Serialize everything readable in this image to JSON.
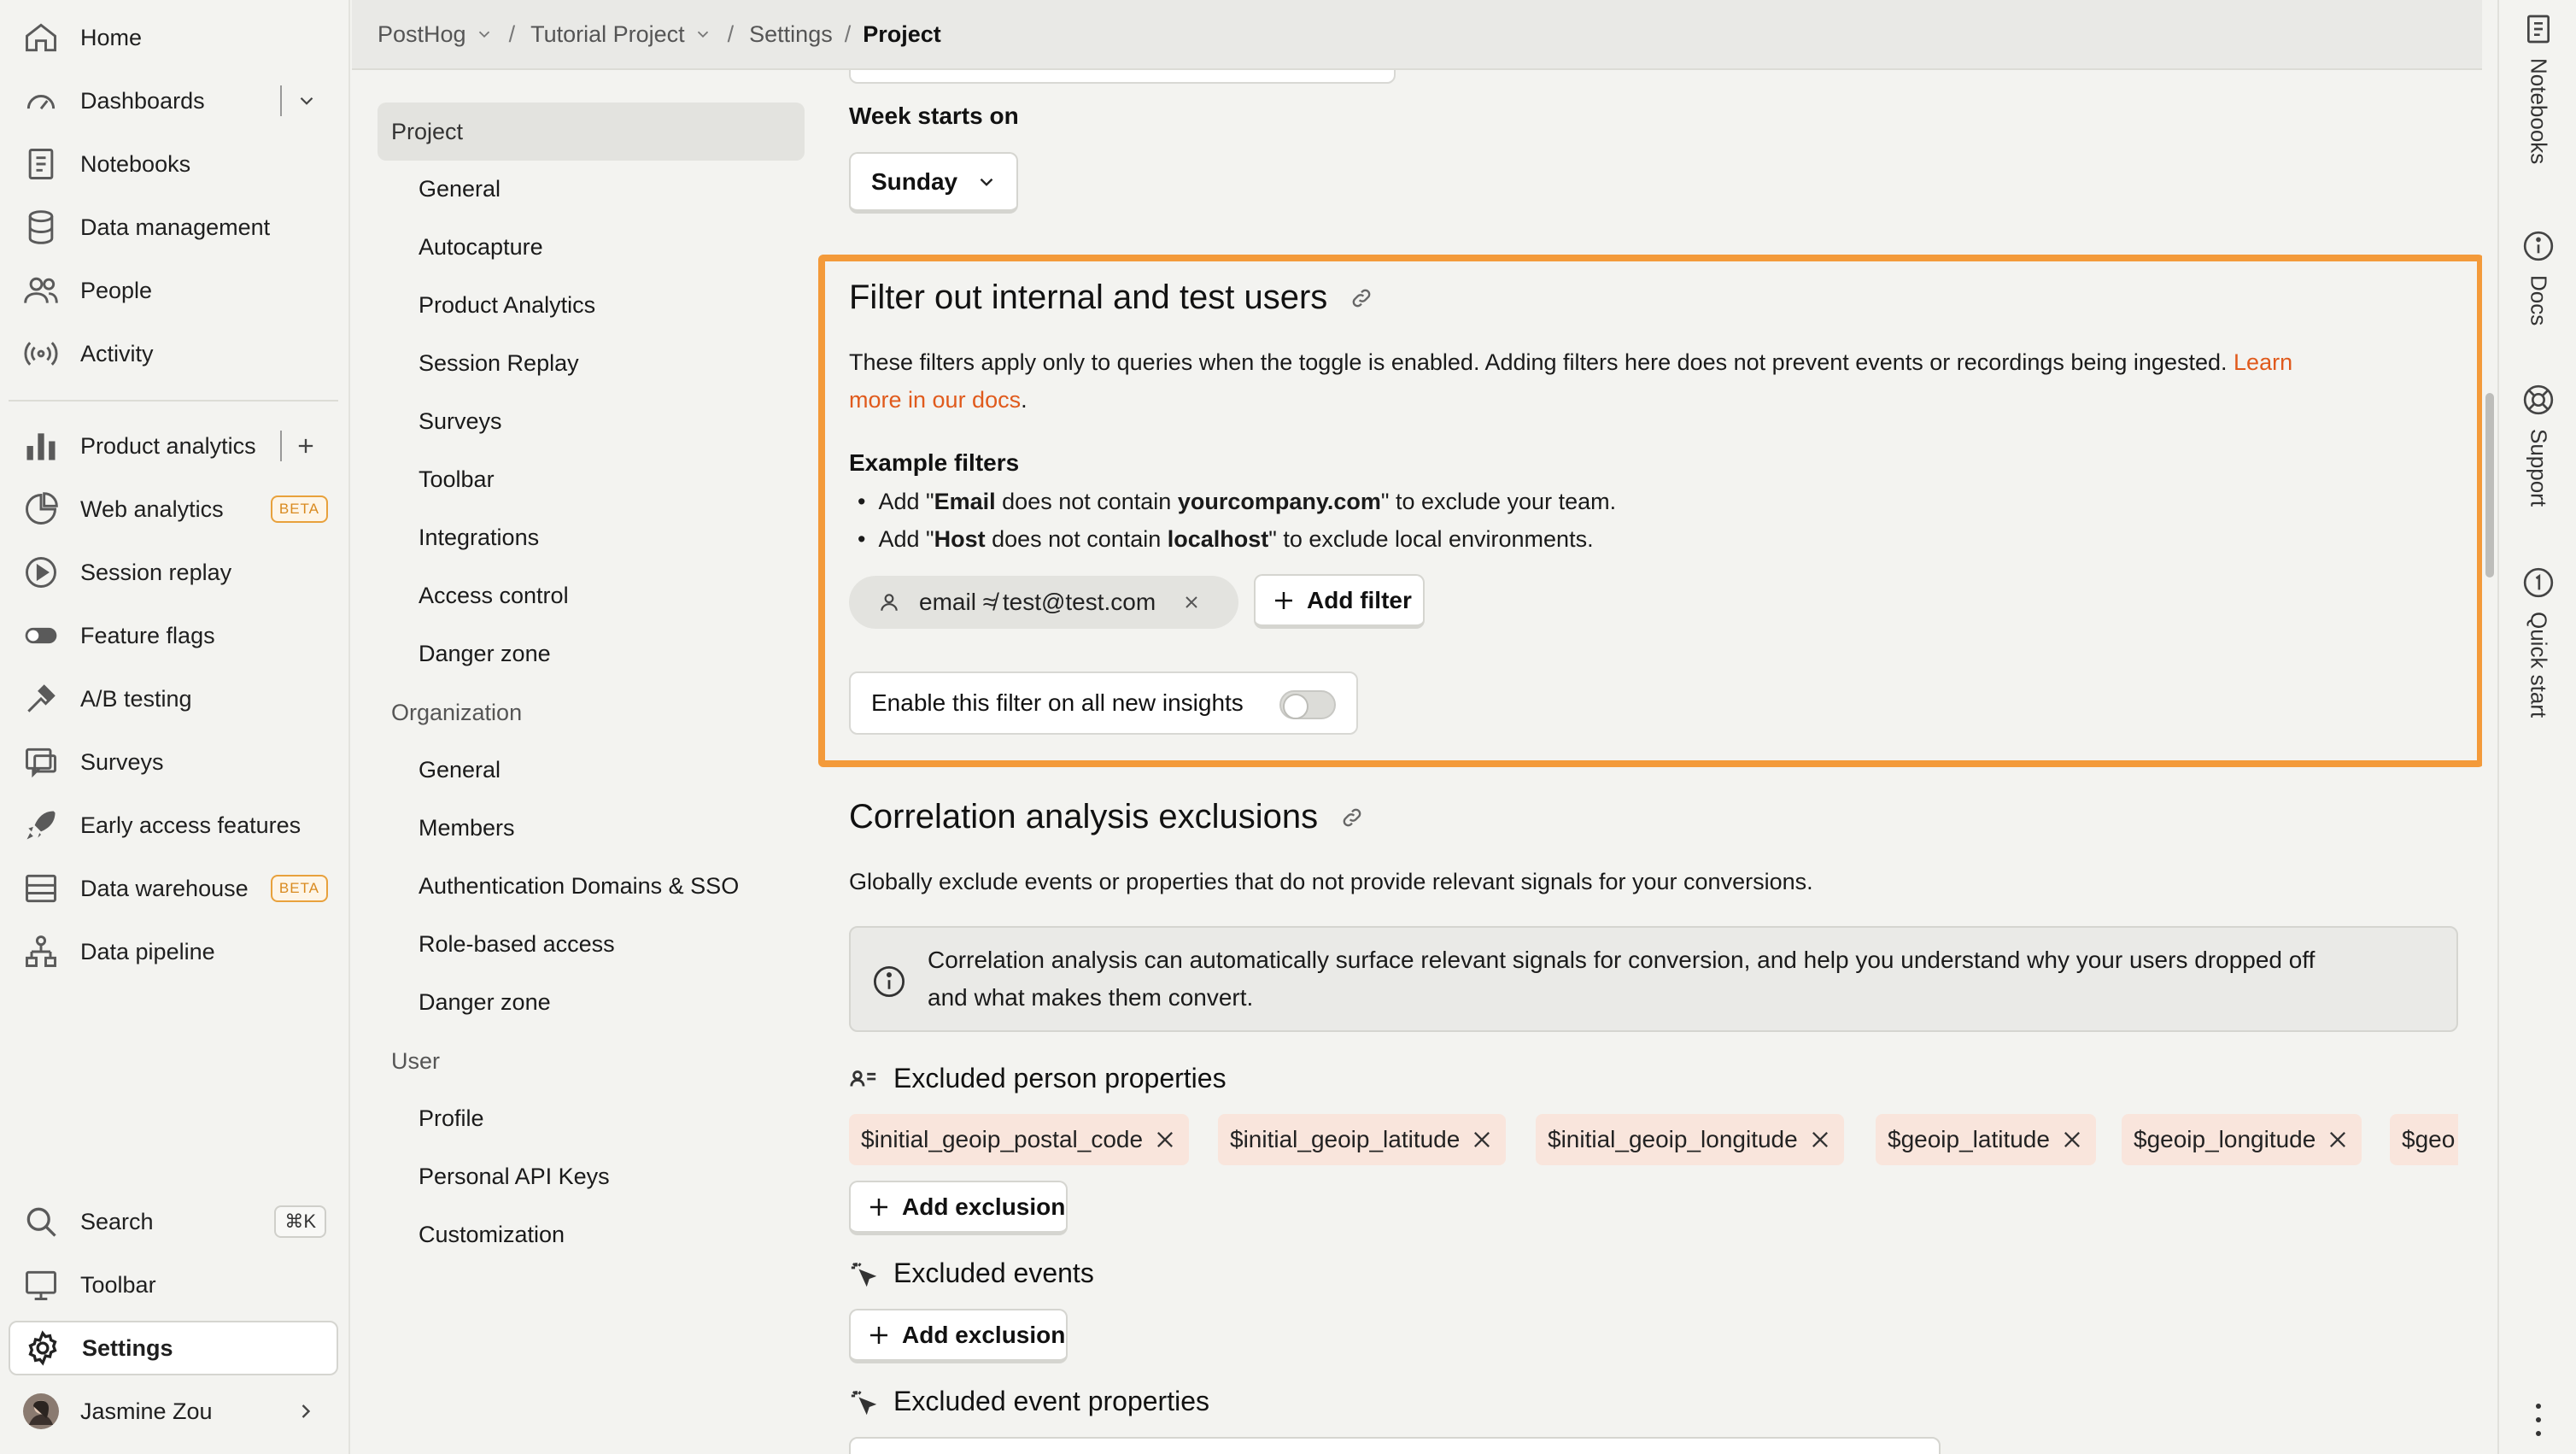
{
  "nav": {
    "items": [
      {
        "label": "Home",
        "icon": "home-icon"
      },
      {
        "label": "Dashboards",
        "icon": "dashboard-icon"
      },
      {
        "label": "Notebooks",
        "icon": "notebook-icon"
      },
      {
        "label": "Data management",
        "icon": "database-icon"
      },
      {
        "label": "People",
        "icon": "people-icon"
      },
      {
        "label": "Activity",
        "icon": "activity-icon"
      },
      {
        "label": "Product analytics",
        "icon": "bar-chart-icon"
      },
      {
        "label": "Web analytics",
        "icon": "pie-chart-icon",
        "badge": "BETA"
      },
      {
        "label": "Session replay",
        "icon": "replay-icon"
      },
      {
        "label": "Feature flags",
        "icon": "toggle-icon"
      },
      {
        "label": "A/B testing",
        "icon": "flask-icon"
      },
      {
        "label": "Surveys",
        "icon": "survey-icon"
      },
      {
        "label": "Early access features",
        "icon": "rocket-icon"
      },
      {
        "label": "Data warehouse",
        "icon": "server-icon",
        "badge": "BETA"
      },
      {
        "label": "Data pipeline",
        "icon": "pipeline-icon"
      }
    ],
    "bottom": {
      "search": "Search",
      "search_shortcut": "⌘K",
      "toolbar": "Toolbar",
      "settings": "Settings",
      "user": "Jasmine Zou"
    }
  },
  "breadcrumbs": {
    "org": "PostHog",
    "project": "Tutorial Project",
    "settings": "Settings",
    "current": "Project"
  },
  "subnav": {
    "project_header": "Project",
    "project_items": [
      "General",
      "Autocapture",
      "Product Analytics",
      "Session Replay",
      "Surveys",
      "Toolbar",
      "Integrations",
      "Access control",
      "Danger zone"
    ],
    "org_header": "Organization",
    "org_items": [
      "General",
      "Members",
      "Authentication Domains & SSO",
      "Role-based access",
      "Danger zone"
    ],
    "user_header": "User",
    "user_items": [
      "Profile",
      "Personal API Keys",
      "Customization"
    ]
  },
  "week": {
    "label": "Week starts on",
    "value": "Sunday"
  },
  "filter_section": {
    "title": "Filter out internal and test users",
    "description": "These filters apply only to queries when the toggle is enabled. Adding filters here does not prevent events or recordings being ingested.",
    "learn_link_1": "Learn",
    "learn_link_2": "more in our docs",
    "period": ".",
    "example_title": "Example filters",
    "example_1": {
      "pre": "Add \"",
      "b1": "Email",
      "mid": " does not contain ",
      "b2": "yourcompany.com",
      "post": "\" to exclude your team."
    },
    "example_2": {
      "pre": "Add \"",
      "b1": "Host",
      "mid": " does not contain ",
      "b2": "localhost",
      "post": "\" to exclude local environments."
    },
    "chip": "email ≉ test@test.com",
    "add_filter": "Add filter",
    "toggle_label": "Enable this filter on all new insights",
    "toggle_on": false
  },
  "correlation": {
    "title": "Correlation analysis exclusions",
    "description": "Globally exclude events or properties that do not provide relevant signals for your conversions.",
    "info_line_1": "Correlation analysis can automatically surface relevant signals for conversion, and help you understand why your users dropped off",
    "info_line_2": "and what makes them convert.",
    "person_props_title": "Excluded person properties",
    "person_props": [
      "$initial_geoip_postal_code",
      "$initial_geoip_latitude",
      "$initial_geoip_longitude",
      "$geoip_latitude",
      "$geoip_longitude",
      "$geo"
    ],
    "add_exclusion": "Add exclusion",
    "events_title": "Excluded events",
    "event_props_title": "Excluded event properties"
  },
  "sidepanel": {
    "tabs": [
      "Notebooks",
      "Docs",
      "Support",
      "Quick start"
    ]
  }
}
